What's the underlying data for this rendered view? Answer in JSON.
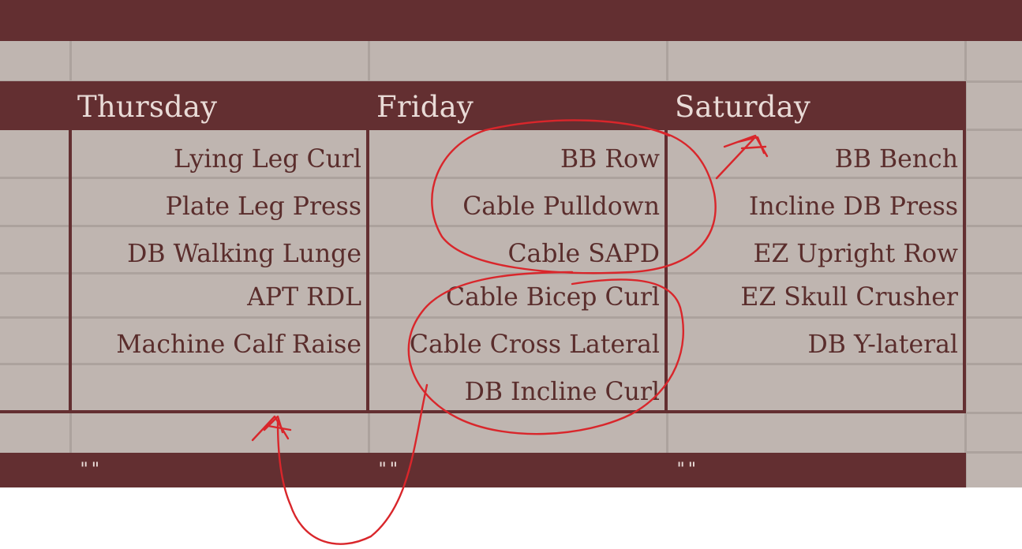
{
  "days": [
    {
      "name": "Thursday",
      "exercises": [
        "Lying Leg Curl",
        "Plate Leg Press",
        "DB Walking Lunge",
        "APT RDL",
        "Machine Calf Raise",
        ""
      ],
      "footer": "\"\""
    },
    {
      "name": "Friday",
      "exercises": [
        "BB Row",
        "Cable Pulldown",
        "Cable SAPD",
        "Cable Bicep Curl",
        "Cable Cross Lateral",
        "DB Incline Curl"
      ],
      "footer": "\"\""
    },
    {
      "name": "Saturday",
      "exercises": [
        "BB Bench",
        "Incline DB Press",
        "EZ Upright Row",
        "EZ Skull Crusher",
        "DB Y-lateral",
        ""
      ],
      "footer": "\"\""
    }
  ],
  "colors": {
    "header_bar": "#632f31",
    "cell_background": "#bfb5b0",
    "header_text": "#e9dbd7",
    "cell_text": "#5a2d2c",
    "annotation_ink": "#d9262b"
  }
}
